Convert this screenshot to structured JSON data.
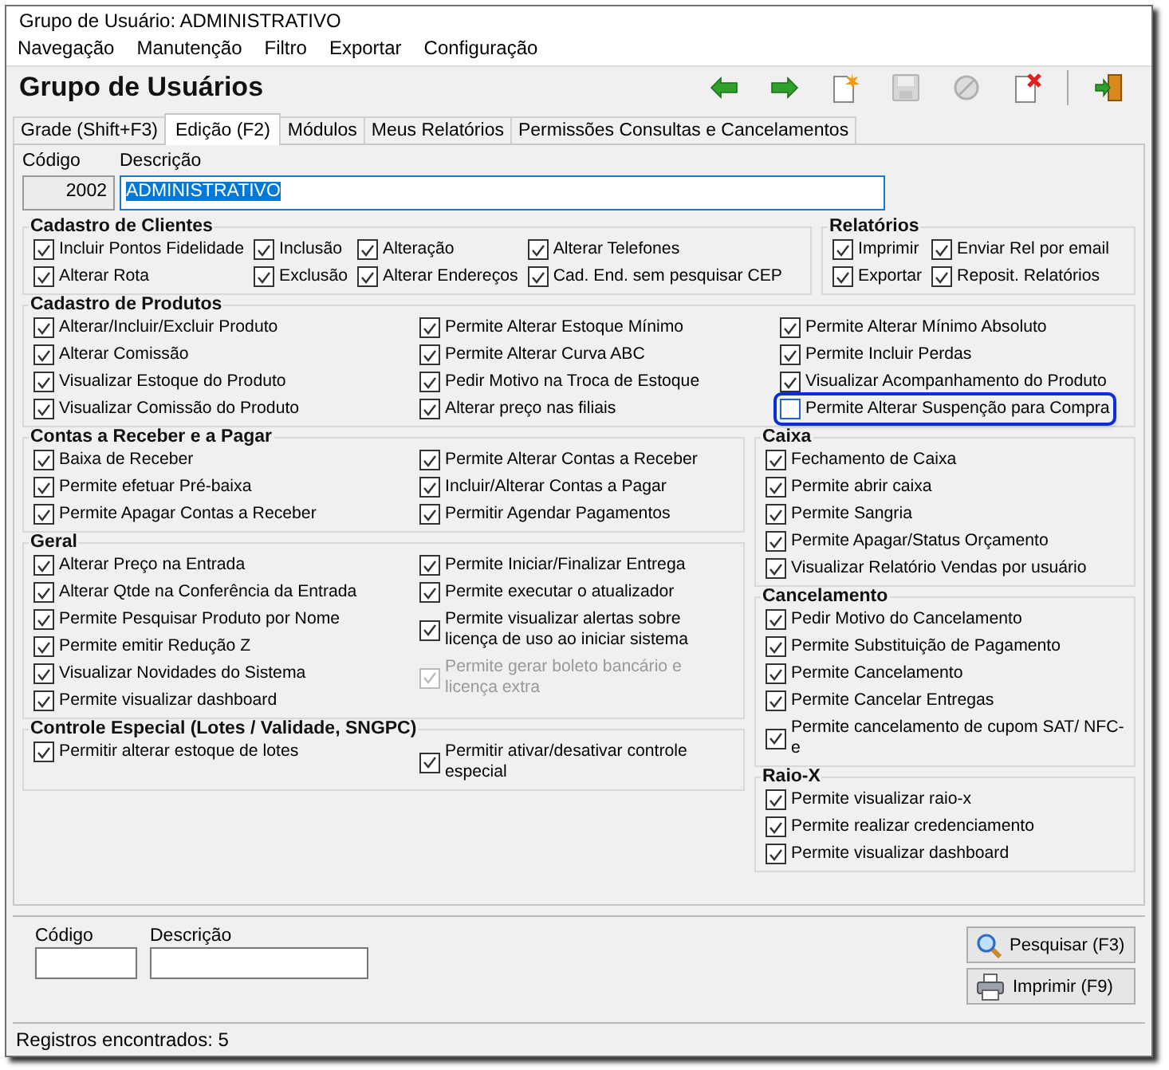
{
  "window": {
    "title": "Grupo de Usuário: ADMINISTRATIVO"
  },
  "menu": [
    "Navegação",
    "Manutenção",
    "Filtro",
    "Exportar",
    "Configuração"
  ],
  "header": {
    "title": "Grupo de Usuários",
    "toolbar": [
      {
        "kind": "back",
        "disabled": false
      },
      {
        "kind": "forward",
        "disabled": false
      },
      {
        "kind": "new",
        "disabled": false
      },
      {
        "kind": "save",
        "disabled": true
      },
      {
        "kind": "cancel",
        "disabled": true
      },
      {
        "kind": "delete",
        "disabled": false
      },
      {
        "kind": "exit",
        "disabled": false
      }
    ]
  },
  "tabs": [
    {
      "label": "Grade (Shift+F3)",
      "selected": false
    },
    {
      "label": "Edição (F2)",
      "selected": true
    },
    {
      "label": "Módulos",
      "selected": false
    },
    {
      "label": "Meus Relatórios",
      "selected": false
    },
    {
      "label": "Permissões Consultas e Cancelamentos",
      "selected": false
    }
  ],
  "record": {
    "code_label": "Código",
    "code": "2002",
    "description_label": "Descrição",
    "description": "ADMINISTRATIVO"
  },
  "top_row": [
    {
      "title": "Cadastro de Clientes",
      "columns": [
        [
          {
            "label": "Incluir Pontos Fidelidade",
            "checked": true,
            "disabled": false,
            "highlighted": false
          },
          {
            "label": "Alterar Rota",
            "checked": true,
            "disabled": false,
            "highlighted": false
          }
        ],
        [
          {
            "label": "Inclusão",
            "checked": true,
            "disabled": false,
            "highlighted": false
          },
          {
            "label": "Exclusão",
            "checked": true,
            "disabled": false,
            "highlighted": false
          }
        ],
        [
          {
            "label": "Alteração",
            "checked": true,
            "disabled": false,
            "highlighted": false
          },
          {
            "label": "Alterar Endereços",
            "checked": true,
            "disabled": false,
            "highlighted": false
          }
        ],
        [
          {
            "label": "Alterar Telefones",
            "checked": true,
            "disabled": false,
            "highlighted": false
          },
          {
            "label": "Cad. End. sem pesquisar CEP",
            "checked": true,
            "disabled": false,
            "highlighted": false
          }
        ]
      ]
    },
    {
      "title": "Relatórios",
      "columns": [
        [
          {
            "label": "Imprimir",
            "checked": true,
            "disabled": false,
            "highlighted": false
          },
          {
            "label": "Exportar",
            "checked": true,
            "disabled": false,
            "highlighted": false
          }
        ],
        [
          {
            "label": "Enviar Rel por email",
            "checked": true,
            "disabled": false,
            "highlighted": false
          },
          {
            "label": "Reposit. Relatórios",
            "checked": true,
            "disabled": false,
            "highlighted": false
          }
        ]
      ]
    }
  ],
  "products": {
    "title": "Cadastro de Produtos",
    "columns": [
      [
        {
          "label": "Alterar/Incluir/Excluir Produto",
          "checked": true,
          "disabled": false,
          "highlighted": false
        },
        {
          "label": "Alterar Comissão",
          "checked": true,
          "disabled": false,
          "highlighted": false
        },
        {
          "label": "Visualizar Estoque do Produto",
          "checked": true,
          "disabled": false,
          "highlighted": false
        },
        {
          "label": "Visualizar Comissão do Produto",
          "checked": true,
          "disabled": false,
          "highlighted": false
        }
      ],
      [
        {
          "label": "Permite Alterar Estoque Mínimo",
          "checked": true,
          "disabled": false,
          "highlighted": false
        },
        {
          "label": "Permite Alterar Curva ABC",
          "checked": true,
          "disabled": false,
          "highlighted": false
        },
        {
          "label": "Pedir Motivo na Troca de Estoque",
          "checked": true,
          "disabled": false,
          "highlighted": false
        },
        {
          "label": "Alterar preço nas filiais",
          "checked": true,
          "disabled": false,
          "highlighted": false
        }
      ],
      [
        {
          "label": "Permite Alterar Mínimo Absoluto",
          "checked": true,
          "disabled": false,
          "highlighted": false
        },
        {
          "label": "Permite Incluir Perdas",
          "checked": true,
          "disabled": false,
          "highlighted": false
        },
        {
          "label": "Visualizar Acompanhamento do Produto",
          "checked": true,
          "disabled": false,
          "highlighted": false
        },
        {
          "label": "Permite Alterar Suspenção para Compra",
          "checked": false,
          "disabled": false,
          "highlighted": true
        }
      ]
    ]
  },
  "left_column": [
    {
      "title": "Contas a Receber e a Pagar",
      "columns": [
        [
          {
            "label": "Baixa de Receber",
            "checked": true,
            "disabled": false,
            "highlighted": false
          },
          {
            "label": "Permite efetuar Pré-baixa",
            "checked": true,
            "disabled": false,
            "highlighted": false
          },
          {
            "label": "Permite Apagar Contas a Receber",
            "checked": true,
            "disabled": false,
            "highlighted": false
          }
        ],
        [
          {
            "label": "Permite Alterar Contas a Receber",
            "checked": true,
            "disabled": false,
            "highlighted": false
          },
          {
            "label": "Incluir/Alterar Contas a Pagar",
            "checked": true,
            "disabled": false,
            "highlighted": false
          },
          {
            "label": "Permitir Agendar Pagamentos",
            "checked": true,
            "disabled": false,
            "highlighted": false
          }
        ]
      ]
    },
    {
      "title": "Geral",
      "columns": [
        [
          {
            "label": "Alterar Preço na Entrada",
            "checked": true,
            "disabled": false,
            "highlighted": false
          },
          {
            "label": "Alterar Qtde na Conferência da Entrada",
            "checked": true,
            "disabled": false,
            "highlighted": false
          },
          {
            "label": "Permite Pesquisar Produto por Nome",
            "checked": true,
            "disabled": false,
            "highlighted": false
          },
          {
            "label": "Permite emitir Redução Z",
            "checked": true,
            "disabled": false,
            "highlighted": false
          },
          {
            "label": "Visualizar Novidades do Sistema",
            "checked": true,
            "disabled": false,
            "highlighted": false
          },
          {
            "label": "Permite visualizar dashboard",
            "checked": true,
            "disabled": false,
            "highlighted": false
          }
        ],
        [
          {
            "label": "Permite Iniciar/Finalizar Entrega",
            "checked": true,
            "disabled": false,
            "highlighted": false
          },
          {
            "label": "Permite executar o atualizador",
            "checked": true,
            "disabled": false,
            "highlighted": false
          },
          {
            "label": "Permite visualizar alertas sobre licença de uso ao iniciar sistema",
            "checked": true,
            "disabled": false,
            "highlighted": false
          },
          {
            "label": "Permite gerar boleto bancário e licença extra",
            "checked": true,
            "disabled": true,
            "highlighted": false
          }
        ]
      ]
    },
    {
      "title": "Controle Especial (Lotes / Validade, SNGPC)",
      "columns": [
        [
          {
            "label": "Permitir alterar estoque de lotes",
            "checked": true,
            "disabled": false,
            "highlighted": false
          }
        ],
        [
          {
            "label": "Permitir ativar/desativar controle especial",
            "checked": true,
            "disabled": false,
            "highlighted": false
          }
        ]
      ]
    }
  ],
  "right_column": [
    {
      "title": "Caixa",
      "columns": [
        [
          {
            "label": "Fechamento de Caixa",
            "checked": true,
            "disabled": false,
            "highlighted": false
          },
          {
            "label": "Permite abrir caixa",
            "checked": true,
            "disabled": false,
            "highlighted": false
          },
          {
            "label": "Permite Sangria",
            "checked": true,
            "disabled": false,
            "highlighted": false
          },
          {
            "label": "Permite Apagar/Status Orçamento",
            "checked": true,
            "disabled": false,
            "highlighted": false
          },
          {
            "label": "Visualizar Relatório Vendas por usuário",
            "checked": true,
            "disabled": false,
            "highlighted": false
          }
        ]
      ]
    },
    {
      "title": "Cancelamento",
      "columns": [
        [
          {
            "label": "Pedir Motivo do Cancelamento",
            "checked": true,
            "disabled": false,
            "highlighted": false
          },
          {
            "label": "Permite Substituição de Pagamento",
            "checked": true,
            "disabled": false,
            "highlighted": false
          },
          {
            "label": "Permite Cancelamento",
            "checked": true,
            "disabled": false,
            "highlighted": false
          },
          {
            "label": "Permite Cancelar Entregas",
            "checked": true,
            "disabled": false,
            "highlighted": false
          },
          {
            "label": "Permite cancelamento de cupom SAT/ NFC-e",
            "checked": true,
            "disabled": false,
            "highlighted": false
          }
        ]
      ]
    },
    {
      "title": "Raio-X",
      "columns": [
        [
          {
            "label": "Permite visualizar raio-x",
            "checked": true,
            "disabled": false,
            "highlighted": false
          },
          {
            "label": "Permite realizar credenciamento",
            "checked": true,
            "disabled": false,
            "highlighted": false
          },
          {
            "label": "Permite visualizar dashboard",
            "checked": true,
            "disabled": false,
            "highlighted": false
          }
        ]
      ]
    }
  ],
  "search": {
    "code_label": "Código",
    "description_label": "Descrição",
    "buttons": [
      {
        "kind": "search",
        "label": "Pesquisar (F3)"
      },
      {
        "kind": "print",
        "label": "Imprimir (F9)"
      }
    ]
  },
  "status_bar": "Registros encontrados: 5"
}
